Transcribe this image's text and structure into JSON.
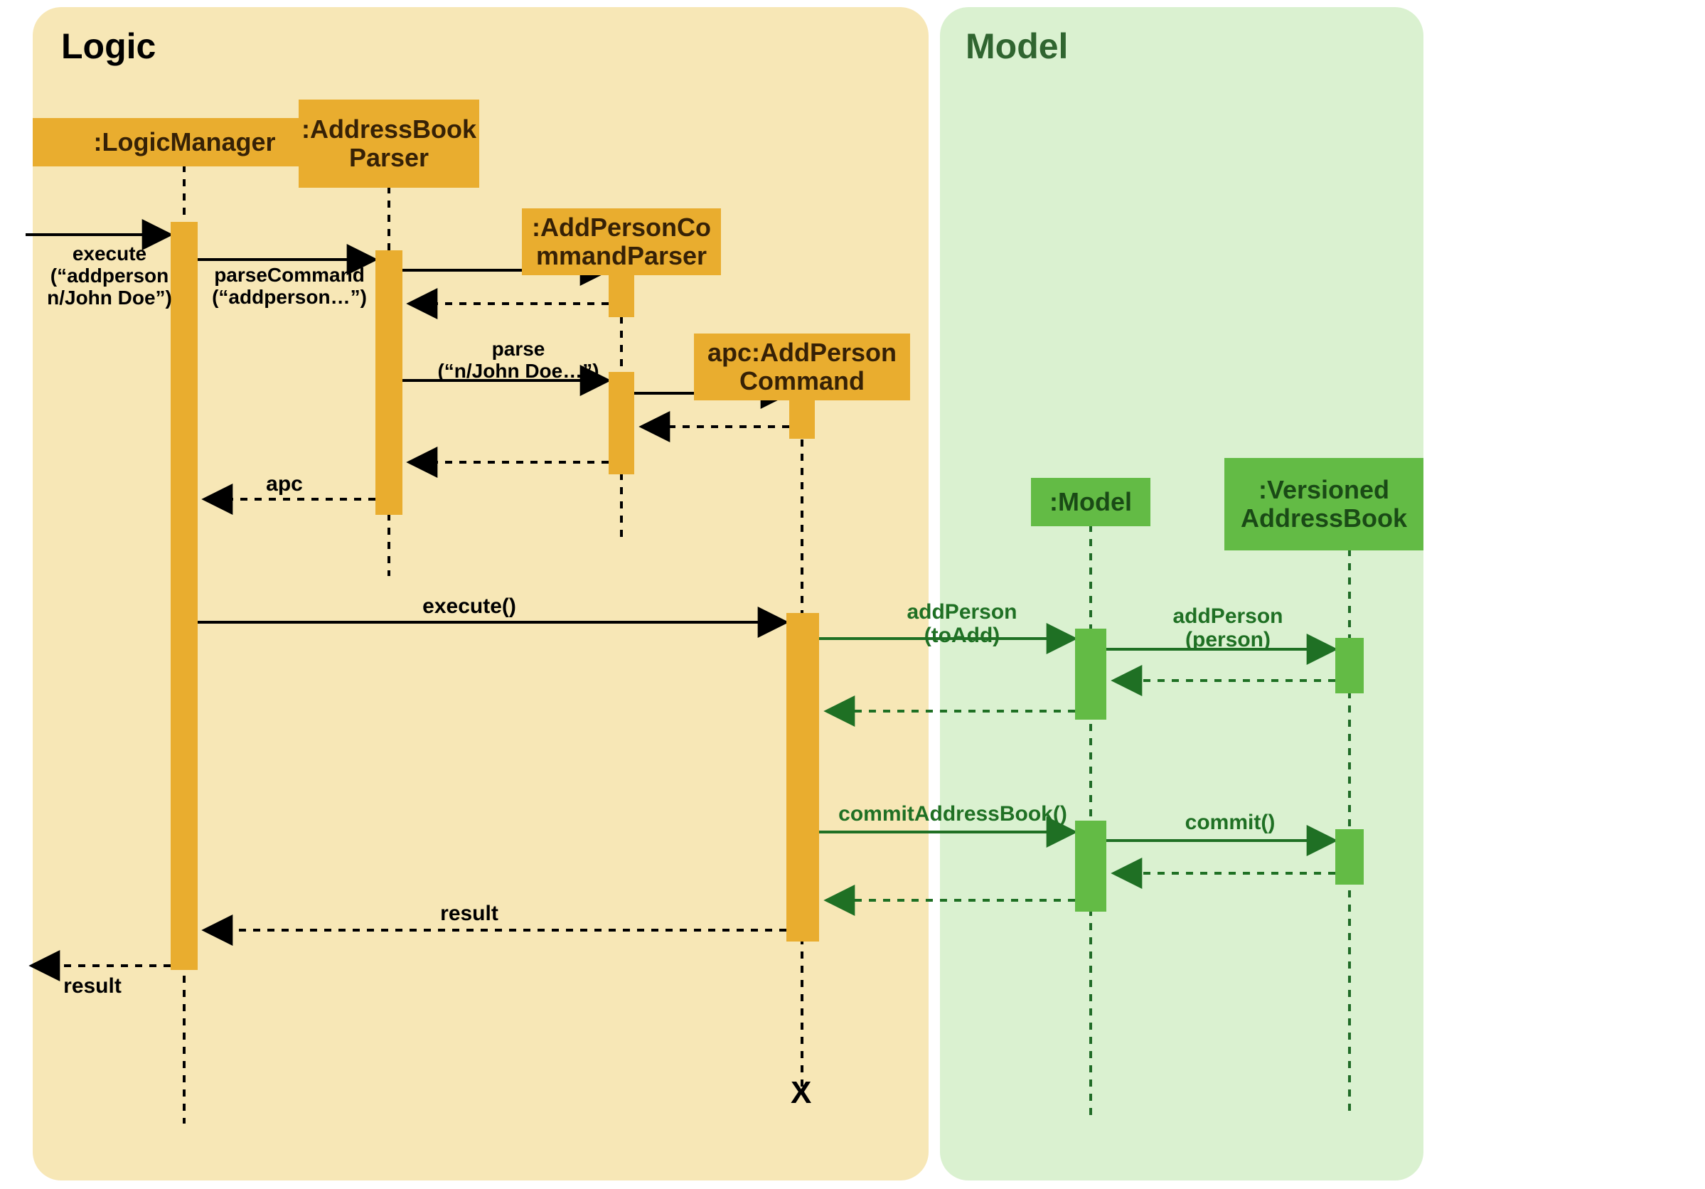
{
  "frames": {
    "logic": "Logic",
    "model": "Model"
  },
  "participants": {
    "logic_manager": ":LogicManager",
    "addressbook_parser": ":AddressBook\nParser",
    "addperson_cmd_parser": ":AddPersonCo\nmmandParser",
    "addperson_command": "apc:AddPerson\nCommand",
    "model": ":Model",
    "versioned_addressbook": ":Versioned\nAddressBook"
  },
  "messages": {
    "execute_in": "execute\n(“addperson\nn/John Doe”)",
    "parse_command": "parseCommand\n(“addperson…”)",
    "parse": "parse\n(“n/John Doe…”)",
    "apc_return": "apc",
    "execute_call": "execute()",
    "add_person_model": "addPerson\n(toAdd)",
    "add_person_vab": "addPerson\n(person)",
    "commit_addressbook": "commitAddressBook()",
    "commit": "commit()",
    "result_inner": "result",
    "result_outer": "result"
  },
  "terminator": "X",
  "colors": {
    "logic_bg": "#f7e7b6",
    "model_bg": "#daf1d0",
    "orange": "#e9ad2f",
    "green": "#63bb45",
    "green_text": "#1f7024",
    "black": "#000000"
  },
  "layout": {
    "note": "UML sequence diagram; lifelines (dashed), activation bars, sync calls (solid arrow, filled head), returns (dashed arrow)."
  }
}
